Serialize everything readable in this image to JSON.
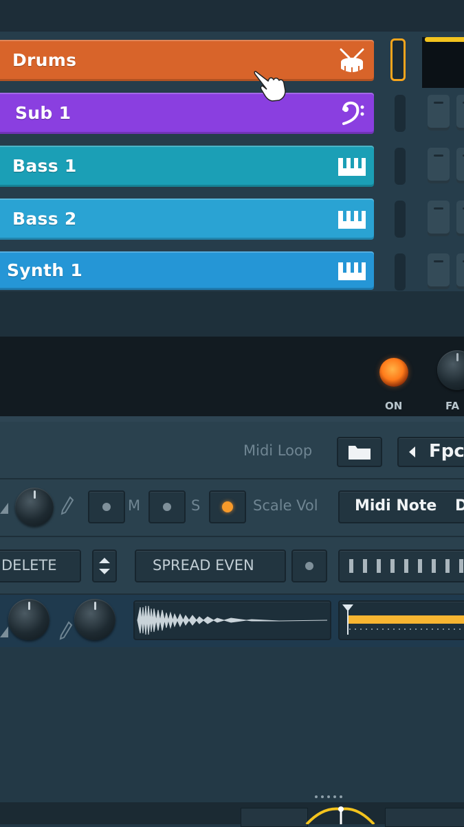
{
  "channels": [
    {
      "label": "Drums",
      "color": "#d8642a",
      "icon": "drum-icon"
    },
    {
      "label": "Sub 1",
      "color": "#8a3fe0",
      "icon": "bass-clef-icon"
    },
    {
      "label": "Bass 1",
      "color": "#1b9fb6",
      "icon": "piano-keys-icon"
    },
    {
      "label": "Bass 2",
      "color": "#2aa3d3",
      "icon": "piano-keys-icon"
    },
    {
      "label": "Synth 1",
      "color": "#2596d6",
      "icon": "piano-keys-icon"
    }
  ],
  "fx": {
    "on_label": "ON",
    "fade_label": "FA"
  },
  "settings": {
    "midi_loop_label": "Midi Loop",
    "preset_label": "Fpc",
    "mute_label": "M",
    "solo_label": "S",
    "scale_vol_label": "Scale Vol",
    "midi_note_label": "Midi Note",
    "midi_note_value": "D",
    "delete_label": "DELETE",
    "spread_even_label": "SPREAD EVEN"
  },
  "colors": {
    "accent_orange": "#f7a51c",
    "panel": "#2a414e",
    "background": "#223846"
  }
}
